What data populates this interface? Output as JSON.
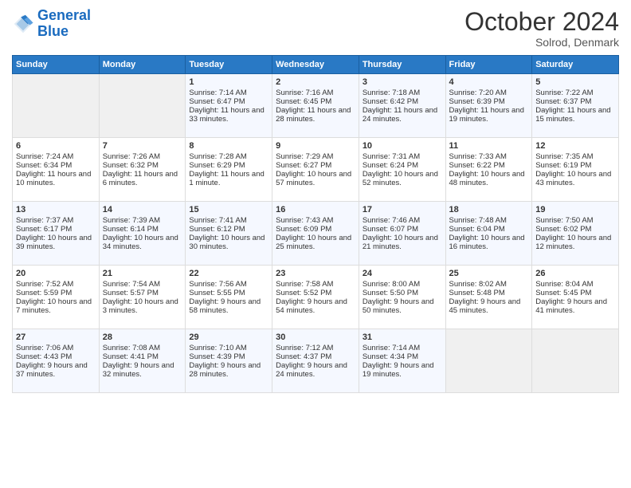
{
  "header": {
    "logo_line1": "General",
    "logo_line2": "Blue",
    "month": "October 2024",
    "location": "Solrod, Denmark"
  },
  "days_of_week": [
    "Sunday",
    "Monday",
    "Tuesday",
    "Wednesday",
    "Thursday",
    "Friday",
    "Saturday"
  ],
  "weeks": [
    [
      {
        "day": "",
        "sunrise": "",
        "sunset": "",
        "daylight": "",
        "empty": true
      },
      {
        "day": "",
        "sunrise": "",
        "sunset": "",
        "daylight": "",
        "empty": true
      },
      {
        "day": "1",
        "sunrise": "Sunrise: 7:14 AM",
        "sunset": "Sunset: 6:47 PM",
        "daylight": "Daylight: 11 hours and 33 minutes.",
        "empty": false
      },
      {
        "day": "2",
        "sunrise": "Sunrise: 7:16 AM",
        "sunset": "Sunset: 6:45 PM",
        "daylight": "Daylight: 11 hours and 28 minutes.",
        "empty": false
      },
      {
        "day": "3",
        "sunrise": "Sunrise: 7:18 AM",
        "sunset": "Sunset: 6:42 PM",
        "daylight": "Daylight: 11 hours and 24 minutes.",
        "empty": false
      },
      {
        "day": "4",
        "sunrise": "Sunrise: 7:20 AM",
        "sunset": "Sunset: 6:39 PM",
        "daylight": "Daylight: 11 hours and 19 minutes.",
        "empty": false
      },
      {
        "day": "5",
        "sunrise": "Sunrise: 7:22 AM",
        "sunset": "Sunset: 6:37 PM",
        "daylight": "Daylight: 11 hours and 15 minutes.",
        "empty": false
      }
    ],
    [
      {
        "day": "6",
        "sunrise": "Sunrise: 7:24 AM",
        "sunset": "Sunset: 6:34 PM",
        "daylight": "Daylight: 11 hours and 10 minutes.",
        "empty": false
      },
      {
        "day": "7",
        "sunrise": "Sunrise: 7:26 AM",
        "sunset": "Sunset: 6:32 PM",
        "daylight": "Daylight: 11 hours and 6 minutes.",
        "empty": false
      },
      {
        "day": "8",
        "sunrise": "Sunrise: 7:28 AM",
        "sunset": "Sunset: 6:29 PM",
        "daylight": "Daylight: 11 hours and 1 minute.",
        "empty": false
      },
      {
        "day": "9",
        "sunrise": "Sunrise: 7:29 AM",
        "sunset": "Sunset: 6:27 PM",
        "daylight": "Daylight: 10 hours and 57 minutes.",
        "empty": false
      },
      {
        "day": "10",
        "sunrise": "Sunrise: 7:31 AM",
        "sunset": "Sunset: 6:24 PM",
        "daylight": "Daylight: 10 hours and 52 minutes.",
        "empty": false
      },
      {
        "day": "11",
        "sunrise": "Sunrise: 7:33 AM",
        "sunset": "Sunset: 6:22 PM",
        "daylight": "Daylight: 10 hours and 48 minutes.",
        "empty": false
      },
      {
        "day": "12",
        "sunrise": "Sunrise: 7:35 AM",
        "sunset": "Sunset: 6:19 PM",
        "daylight": "Daylight: 10 hours and 43 minutes.",
        "empty": false
      }
    ],
    [
      {
        "day": "13",
        "sunrise": "Sunrise: 7:37 AM",
        "sunset": "Sunset: 6:17 PM",
        "daylight": "Daylight: 10 hours and 39 minutes.",
        "empty": false
      },
      {
        "day": "14",
        "sunrise": "Sunrise: 7:39 AM",
        "sunset": "Sunset: 6:14 PM",
        "daylight": "Daylight: 10 hours and 34 minutes.",
        "empty": false
      },
      {
        "day": "15",
        "sunrise": "Sunrise: 7:41 AM",
        "sunset": "Sunset: 6:12 PM",
        "daylight": "Daylight: 10 hours and 30 minutes.",
        "empty": false
      },
      {
        "day": "16",
        "sunrise": "Sunrise: 7:43 AM",
        "sunset": "Sunset: 6:09 PM",
        "daylight": "Daylight: 10 hours and 25 minutes.",
        "empty": false
      },
      {
        "day": "17",
        "sunrise": "Sunrise: 7:46 AM",
        "sunset": "Sunset: 6:07 PM",
        "daylight": "Daylight: 10 hours and 21 minutes.",
        "empty": false
      },
      {
        "day": "18",
        "sunrise": "Sunrise: 7:48 AM",
        "sunset": "Sunset: 6:04 PM",
        "daylight": "Daylight: 10 hours and 16 minutes.",
        "empty": false
      },
      {
        "day": "19",
        "sunrise": "Sunrise: 7:50 AM",
        "sunset": "Sunset: 6:02 PM",
        "daylight": "Daylight: 10 hours and 12 minutes.",
        "empty": false
      }
    ],
    [
      {
        "day": "20",
        "sunrise": "Sunrise: 7:52 AM",
        "sunset": "Sunset: 5:59 PM",
        "daylight": "Daylight: 10 hours and 7 minutes.",
        "empty": false
      },
      {
        "day": "21",
        "sunrise": "Sunrise: 7:54 AM",
        "sunset": "Sunset: 5:57 PM",
        "daylight": "Daylight: 10 hours and 3 minutes.",
        "empty": false
      },
      {
        "day": "22",
        "sunrise": "Sunrise: 7:56 AM",
        "sunset": "Sunset: 5:55 PM",
        "daylight": "Daylight: 9 hours and 58 minutes.",
        "empty": false
      },
      {
        "day": "23",
        "sunrise": "Sunrise: 7:58 AM",
        "sunset": "Sunset: 5:52 PM",
        "daylight": "Daylight: 9 hours and 54 minutes.",
        "empty": false
      },
      {
        "day": "24",
        "sunrise": "Sunrise: 8:00 AM",
        "sunset": "Sunset: 5:50 PM",
        "daylight": "Daylight: 9 hours and 50 minutes.",
        "empty": false
      },
      {
        "day": "25",
        "sunrise": "Sunrise: 8:02 AM",
        "sunset": "Sunset: 5:48 PM",
        "daylight": "Daylight: 9 hours and 45 minutes.",
        "empty": false
      },
      {
        "day": "26",
        "sunrise": "Sunrise: 8:04 AM",
        "sunset": "Sunset: 5:45 PM",
        "daylight": "Daylight: 9 hours and 41 minutes.",
        "empty": false
      }
    ],
    [
      {
        "day": "27",
        "sunrise": "Sunrise: 7:06 AM",
        "sunset": "Sunset: 4:43 PM",
        "daylight": "Daylight: 9 hours and 37 minutes.",
        "empty": false
      },
      {
        "day": "28",
        "sunrise": "Sunrise: 7:08 AM",
        "sunset": "Sunset: 4:41 PM",
        "daylight": "Daylight: 9 hours and 32 minutes.",
        "empty": false
      },
      {
        "day": "29",
        "sunrise": "Sunrise: 7:10 AM",
        "sunset": "Sunset: 4:39 PM",
        "daylight": "Daylight: 9 hours and 28 minutes.",
        "empty": false
      },
      {
        "day": "30",
        "sunrise": "Sunrise: 7:12 AM",
        "sunset": "Sunset: 4:37 PM",
        "daylight": "Daylight: 9 hours and 24 minutes.",
        "empty": false
      },
      {
        "day": "31",
        "sunrise": "Sunrise: 7:14 AM",
        "sunset": "Sunset: 4:34 PM",
        "daylight": "Daylight: 9 hours and 19 minutes.",
        "empty": false
      },
      {
        "day": "",
        "sunrise": "",
        "sunset": "",
        "daylight": "",
        "empty": true
      },
      {
        "day": "",
        "sunrise": "",
        "sunset": "",
        "daylight": "",
        "empty": true
      }
    ]
  ]
}
